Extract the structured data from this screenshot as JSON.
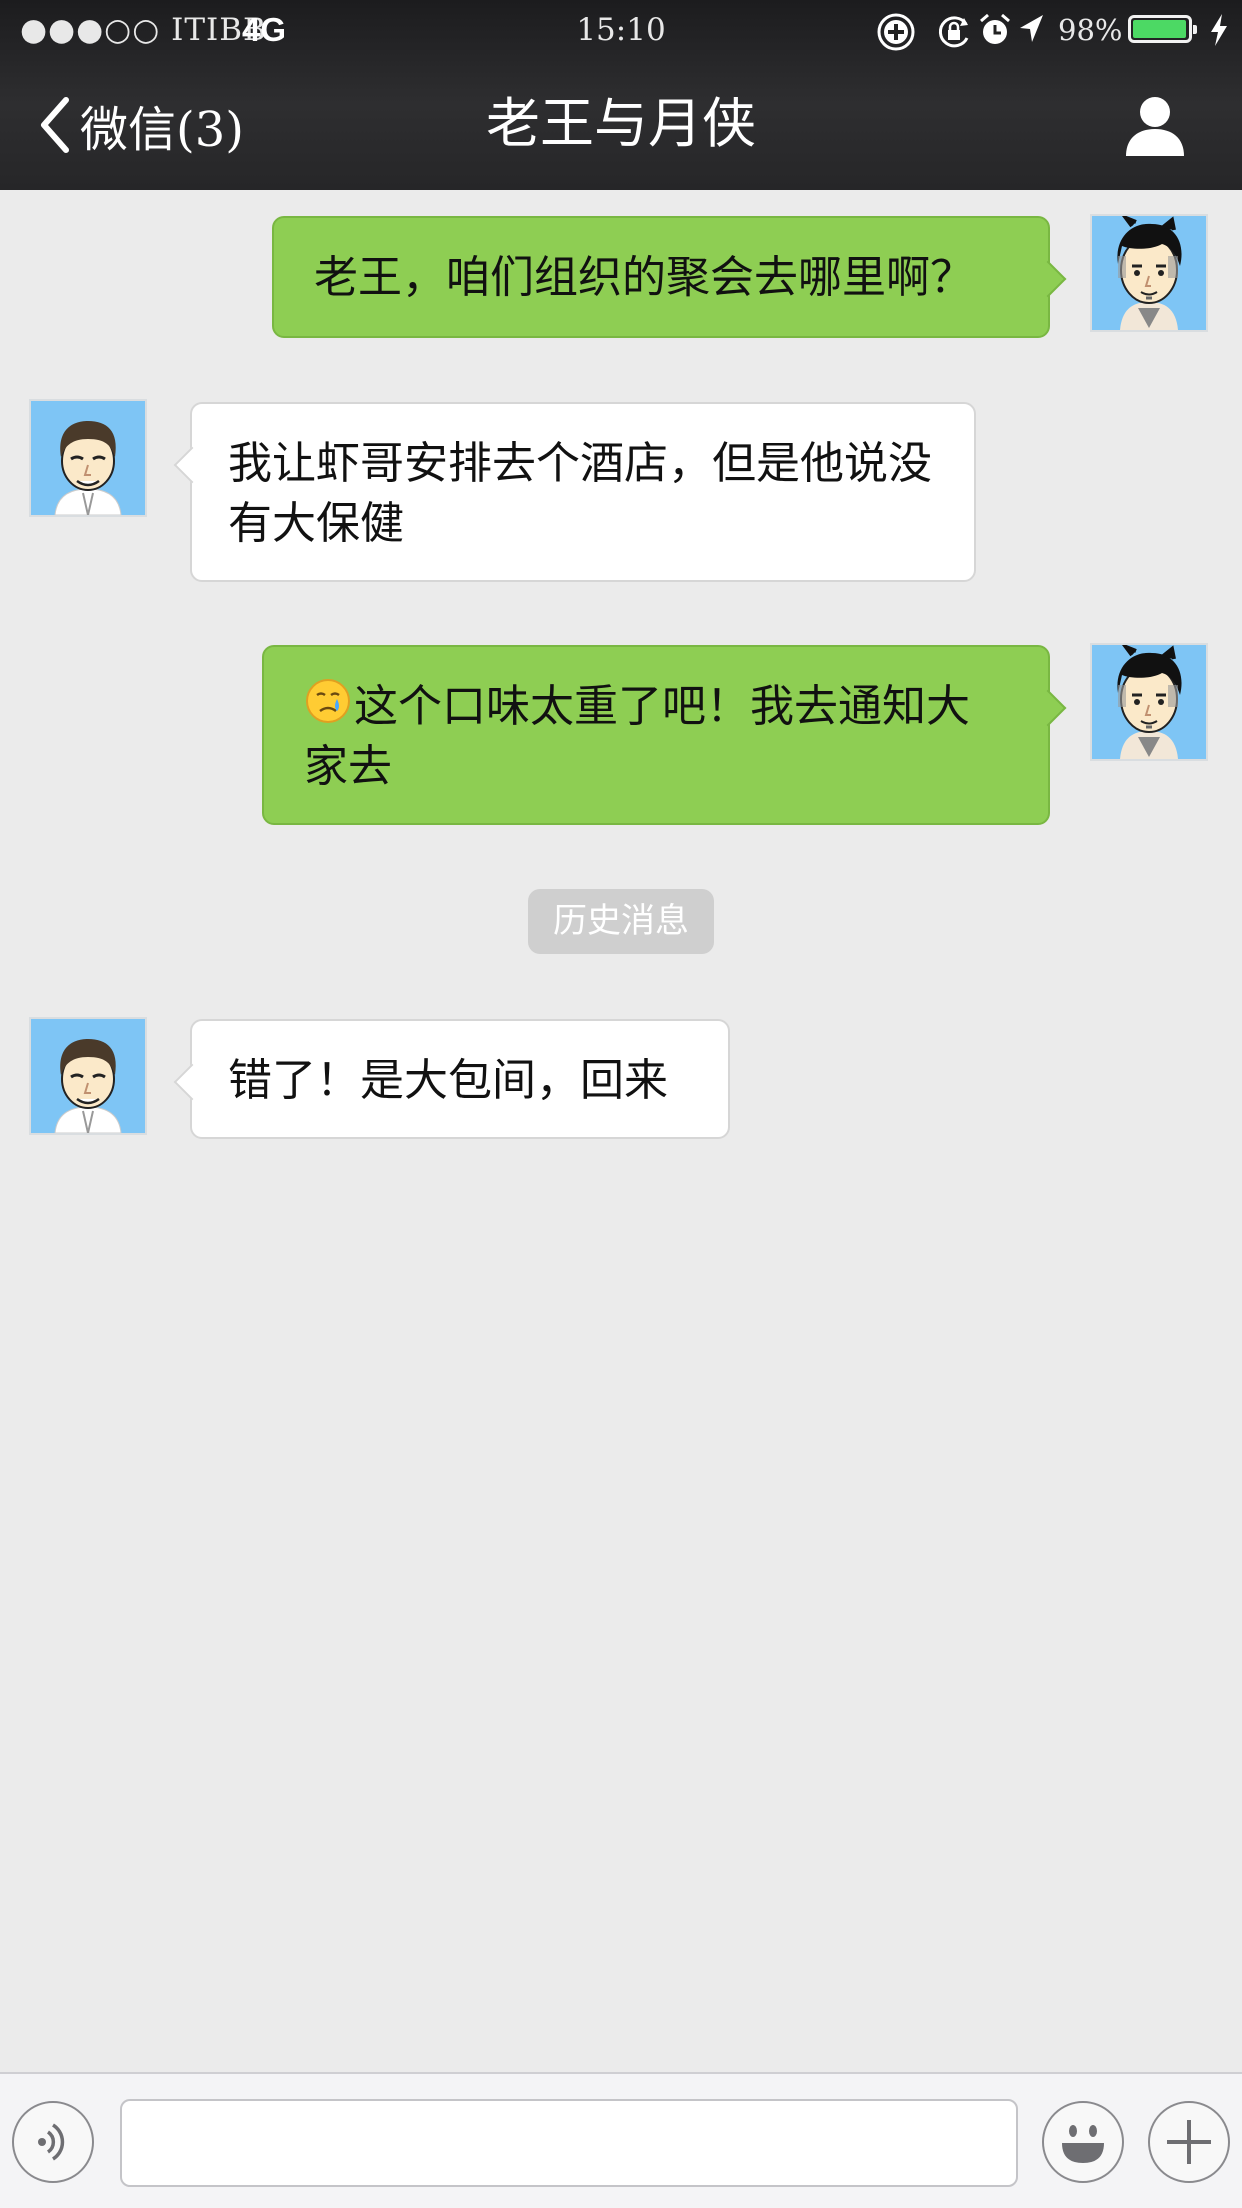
{
  "status_bar": {
    "carrier": "●●●○○ ITIBB",
    "network": "4G",
    "time": "15:10",
    "battery_percent_text": "98%",
    "battery_level": 0.98,
    "icons": [
      "plus-circle-icon",
      "rotation-lock-icon",
      "alarm-icon",
      "location-arrow-icon",
      "battery-icon",
      "charging-bolt-icon"
    ]
  },
  "nav": {
    "back_label": "微信(3)",
    "title": "老王与月侠",
    "back_icon": "chevron-left-icon",
    "profile_icon": "person-icon"
  },
  "messages": [
    {
      "side": "right",
      "sender": "self",
      "text": "老王，咱们组织的聚会去哪里啊？"
    },
    {
      "side": "left",
      "sender": "老王",
      "text": "我让虾哥安排去个酒店，但是他说没有大保健"
    },
    {
      "side": "right",
      "sender": "self",
      "emoji": "crying-face-emoji",
      "text": "这个口味太重了吧！我去通知大家去"
    },
    {
      "side": "left",
      "sender": "老王",
      "text": "错了！是大包间，回来"
    }
  ],
  "system_notice": "历史消息",
  "input_bar": {
    "value": "",
    "icons": [
      "voice-icon",
      "emoji-smile-icon",
      "plus-icon"
    ]
  },
  "colors": {
    "nav_background": "#262628",
    "chat_background": "#ebebeb",
    "self_bubble": "#8ece53",
    "other_bubble": "#ffffff",
    "avatar_background": "#7ec5f5",
    "battery_fill": "#4cd964"
  }
}
